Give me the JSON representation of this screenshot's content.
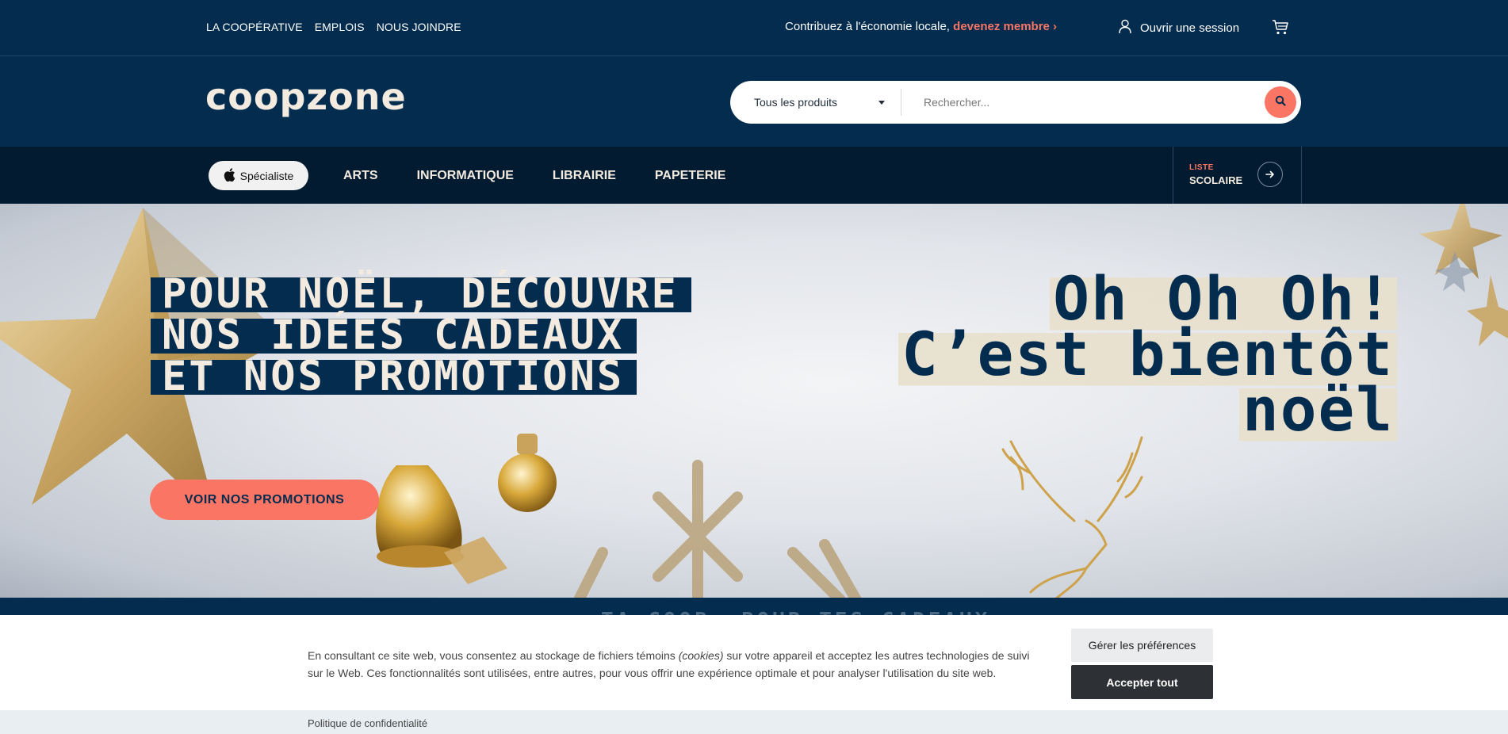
{
  "topbar": {
    "links": [
      "LA COOPÉRATIVE",
      "EMPLOIS",
      "NOUS JOINDRE"
    ],
    "promo_text": "Contribuez à l'économie locale,",
    "promo_cta": "devenez membre ›",
    "login_label": "Ouvrir une session"
  },
  "header": {
    "logo": "coopzone",
    "search_category": "Tous les produits",
    "search_placeholder": "Rechercher..."
  },
  "nav": {
    "specialist_label": "Spécialiste",
    "items": [
      "ARTS",
      "INFORMATIQUE",
      "LIBRAIRIE",
      "PAPETERIE"
    ],
    "liste_small": "LISTE",
    "liste_big": "SCOLAIRE"
  },
  "hero": {
    "headline": [
      "POUR NOËL, DÉCOUVRE",
      "NOS IDÉES CADEAUX",
      "ET NOS PROMOTIONS"
    ],
    "button_label": "VOIR NOS PROMOTIONS",
    "tagline": [
      "Oh Oh Oh!",
      "C’est bientôt",
      "noël"
    ]
  },
  "strip_text": "TA COOP, POUR TES CADEAUX",
  "cookie": {
    "text_before": "En consultant ce site web, vous consentez au stockage de fichiers témoins ",
    "text_em": "(cookies)",
    "text_after": " sur votre appareil et acceptez les autres technologies de suivi sur le Web. Ces fonctionnalités sont utilisées, entre autres, pour vous offrir une expérience optimale et pour analyser l'utilisation du site web.",
    "prefs_button": "Gérer les préférences",
    "accept_button": "Accepter tout",
    "privacy_link": "Politique de confidentialité"
  },
  "colors": {
    "navy": "#032c4f",
    "nav_dark": "#021b30",
    "accent": "#fb7564",
    "cream": "#f3ebdf"
  }
}
